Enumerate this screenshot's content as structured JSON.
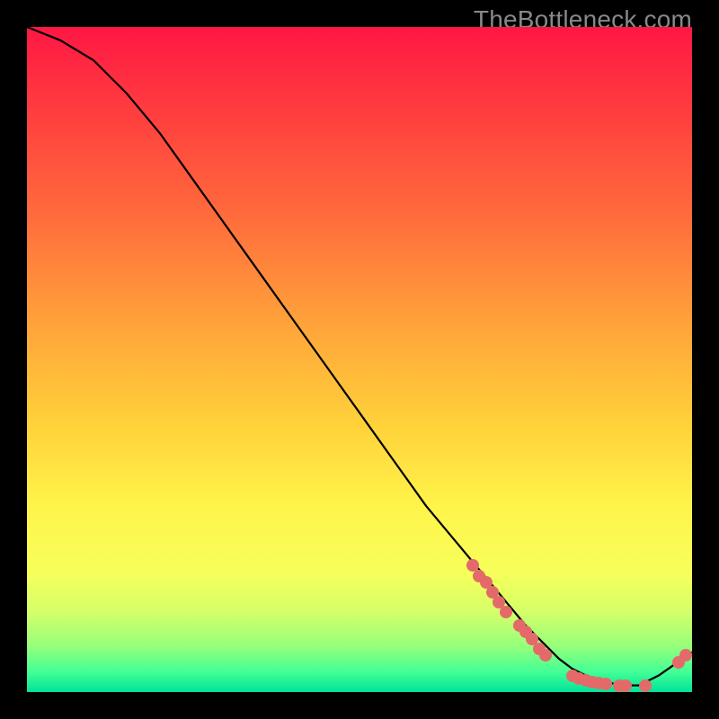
{
  "watermark": "TheBottleneck.com",
  "colors": {
    "black": "#000000",
    "curve": "#000000",
    "marker": "#e46a6a"
  },
  "chart_data": {
    "type": "line",
    "title": "",
    "xlabel": "",
    "ylabel": "",
    "xlim": [
      0,
      100
    ],
    "ylim": [
      0,
      100
    ],
    "grid": false,
    "legend": false,
    "gradient_stops": [
      {
        "pct": 0,
        "color": "#ff1744"
      },
      {
        "pct": 12,
        "color": "#ff3b3f"
      },
      {
        "pct": 28,
        "color": "#ff6a3c"
      },
      {
        "pct": 45,
        "color": "#ffa43a"
      },
      {
        "pct": 60,
        "color": "#ffd23a"
      },
      {
        "pct": 72,
        "color": "#fff44a"
      },
      {
        "pct": 82,
        "color": "#f7ff5a"
      },
      {
        "pct": 88,
        "color": "#d4ff6a"
      },
      {
        "pct": 93,
        "color": "#98ff7a"
      },
      {
        "pct": 97,
        "color": "#42ff95"
      },
      {
        "pct": 100,
        "color": "#00e39a"
      }
    ],
    "series": [
      {
        "name": "bottleneck-curve",
        "x": [
          0,
          5,
          10,
          15,
          20,
          25,
          30,
          35,
          40,
          45,
          50,
          55,
          60,
          65,
          70,
          75,
          78,
          80,
          82,
          84,
          86,
          88,
          90,
          92,
          95,
          100
        ],
        "y": [
          100,
          98,
          95,
          90,
          84,
          77,
          70,
          63,
          56,
          49,
          42,
          35,
          28,
          22,
          16,
          10,
          7,
          5,
          3.5,
          2.5,
          1.8,
          1.3,
          1,
          1,
          2.5,
          6
        ]
      }
    ],
    "markers": [
      {
        "x": 67,
        "y": 19
      },
      {
        "x": 68,
        "y": 17.5
      },
      {
        "x": 69,
        "y": 16.5
      },
      {
        "x": 70,
        "y": 15
      },
      {
        "x": 71,
        "y": 13.5
      },
      {
        "x": 72,
        "y": 12
      },
      {
        "x": 74,
        "y": 10
      },
      {
        "x": 75,
        "y": 9
      },
      {
        "x": 76,
        "y": 8
      },
      {
        "x": 77,
        "y": 6.5
      },
      {
        "x": 78,
        "y": 5.5
      },
      {
        "x": 82,
        "y": 2.5
      },
      {
        "x": 83,
        "y": 2.0
      },
      {
        "x": 84,
        "y": 1.7
      },
      {
        "x": 85,
        "y": 1.5
      },
      {
        "x": 86,
        "y": 1.3
      },
      {
        "x": 87,
        "y": 1.2
      },
      {
        "x": 89,
        "y": 1.0
      },
      {
        "x": 90,
        "y": 1.0
      },
      {
        "x": 93,
        "y": 1.0
      },
      {
        "x": 98,
        "y": 4.5
      },
      {
        "x": 99,
        "y": 5.5
      }
    ]
  }
}
